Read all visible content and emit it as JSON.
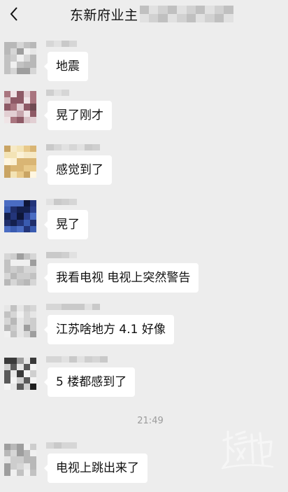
{
  "header": {
    "back_icon": "chevron-left-icon",
    "title": "东新府业主"
  },
  "messages": [
    {
      "text": "地震"
    },
    {
      "text": "晃了刚才"
    },
    {
      "text": "感觉到了"
    },
    {
      "text": "晃了"
    },
    {
      "text": "我看电视 电视上突然警告"
    },
    {
      "text": "江苏啥地方 4.1 好像"
    },
    {
      "text": "5 楼都感到了"
    },
    {
      "text": "电视上跳出来了"
    }
  ],
  "timestamp": "21:49",
  "watermark": {
    "icon": "chao-news-logo",
    "lettering": "橙柿"
  },
  "colors": {
    "background": "#ededed",
    "bubble": "#ffffff",
    "text": "#111111",
    "timestamp": "#9b9b9b"
  }
}
